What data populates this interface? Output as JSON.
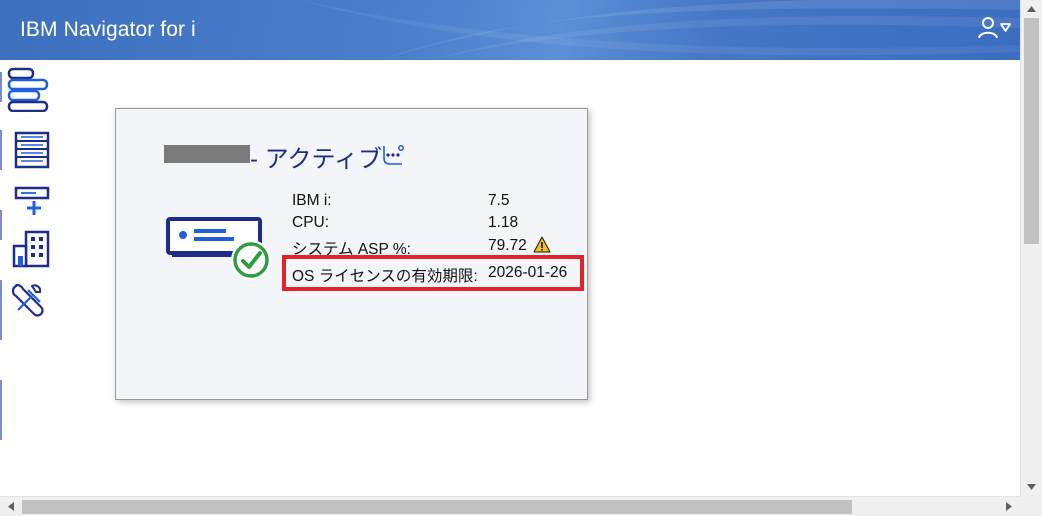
{
  "header": {
    "title": "IBM Navigator for i",
    "user_icon": "user-menu-icon"
  },
  "nav": [
    {
      "name": "summary-icon"
    },
    {
      "name": "server-list-icon"
    },
    {
      "name": "add-system-icon"
    },
    {
      "name": "building-icon"
    },
    {
      "name": "tools-icon"
    }
  ],
  "card": {
    "status": "- アクティブ",
    "rows": [
      {
        "label": "IBM i:",
        "value": "7.5"
      },
      {
        "label": "CPU:",
        "value": "1.18"
      },
      {
        "label": "システム ASP %:",
        "value": "79.72"
      },
      {
        "label": "OS ライセンスの有効期限:",
        "value": "2026-01-26"
      }
    ],
    "status_color": "#2e9e3e",
    "warning_color": "#f1c21b",
    "highlight_color": "#e3232b"
  },
  "colors": {
    "header": "#4a7fcc",
    "nav_icon": "#1f2d8a"
  }
}
